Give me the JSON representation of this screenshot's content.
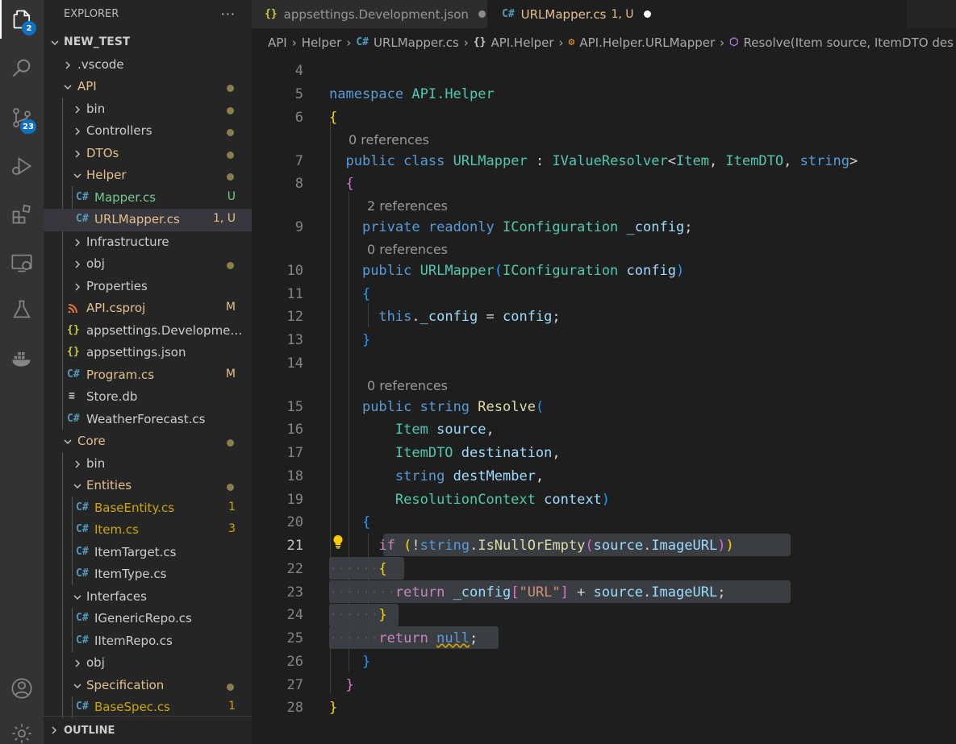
{
  "activity_bar": {
    "explorer_badge": "2",
    "source_control_badge": "23",
    "icons": [
      "files-icon",
      "search-icon",
      "source-control-icon",
      "run-debug-icon",
      "extensions-icon",
      "remote-explorer-icon",
      "testing-icon",
      "docker-icon",
      "account-icon",
      "settings-gear-icon"
    ]
  },
  "explorer": {
    "title": "EXPLORER",
    "more": "···",
    "root": "NEW_TEST",
    "items": [
      {
        "label": ".vscode",
        "status": ""
      },
      {
        "label": "API",
        "status": ""
      },
      {
        "label": "bin",
        "status": ""
      },
      {
        "label": "Controllers",
        "status": ""
      },
      {
        "label": "DTOs",
        "status": ""
      },
      {
        "label": "Helper",
        "status": ""
      },
      {
        "label": "Mapper.cs",
        "status": "U"
      },
      {
        "label": "URLMapper.cs",
        "status": "1, U"
      },
      {
        "label": "Infrastructure",
        "status": ""
      },
      {
        "label": "obj",
        "status": ""
      },
      {
        "label": "Properties",
        "status": ""
      },
      {
        "label": "API.csproj",
        "status": "M"
      },
      {
        "label": "appsettings.Development.j...",
        "status": ""
      },
      {
        "label": "appsettings.json",
        "status": ""
      },
      {
        "label": "Program.cs",
        "status": "M"
      },
      {
        "label": "Store.db",
        "status": ""
      },
      {
        "label": "WeatherForecast.cs",
        "status": ""
      },
      {
        "label": "Core",
        "status": ""
      },
      {
        "label": "bin",
        "status": ""
      },
      {
        "label": "Entities",
        "status": ""
      },
      {
        "label": "BaseEntity.cs",
        "status": "1"
      },
      {
        "label": "Item.cs",
        "status": "3"
      },
      {
        "label": "ItemTarget.cs",
        "status": ""
      },
      {
        "label": "ItemType.cs",
        "status": ""
      },
      {
        "label": "Interfaces",
        "status": ""
      },
      {
        "label": "IGenericRepo.cs",
        "status": ""
      },
      {
        "label": "IItemRepo.cs",
        "status": ""
      },
      {
        "label": "obj",
        "status": ""
      },
      {
        "label": "Specification",
        "status": ""
      },
      {
        "label": "BaseSpec.cs",
        "status": "1"
      }
    ],
    "outline": "OUTLINE"
  },
  "tabs": [
    {
      "icon": "{}",
      "label": "appsettings.Development.json"
    },
    {
      "icon": "C#",
      "label": "URLMapper.cs",
      "status": "1, U"
    }
  ],
  "breadcrumb": {
    "parts": [
      "API",
      "Helper",
      "URLMapper.cs",
      "API.Helper",
      "API.Helper.URLMapper",
      "Resolve(Item source, ItemDTO des"
    ]
  },
  "editor": {
    "code_lens": {
      "l7": "0 references",
      "l9": "2 references",
      "l10": "0 references",
      "l15": "0 references"
    },
    "line_numbers": [
      "4",
      "5",
      "6",
      "7",
      "8",
      "9",
      "10",
      "11",
      "12",
      "13",
      "14",
      "15",
      "16",
      "17",
      "18",
      "19",
      "20",
      "21",
      "22",
      "23",
      "24",
      "25",
      "26",
      "27",
      "28"
    ],
    "current_line": "21",
    "code": {
      "namespace_kw": "namespace",
      "namespace_name": "API.Helper",
      "public": "public",
      "class": "class",
      "class_name": "URLMapper",
      "colon": " : ",
      "interface": "IValueResolver",
      "generic_open": "<",
      "item": "Item",
      "itemdto": "ItemDTO",
      "string": "string",
      "generic_close": ">",
      "private": "private",
      "readonly": "readonly",
      "iconfig": "IConfiguration",
      "config_field": "_config",
      "config_param": "config",
      "this": "this",
      "resolve": "Resolve",
      "source": "source",
      "destination": "destination",
      "destMember": "destMember",
      "resolution_context": "ResolutionContext",
      "context": "context",
      "if": "if",
      "is_null": "IsNullOrEmpty",
      "image_url": "ImageURL",
      "return": "return",
      "url_key": "\"URL\"",
      "null": "null"
    }
  }
}
